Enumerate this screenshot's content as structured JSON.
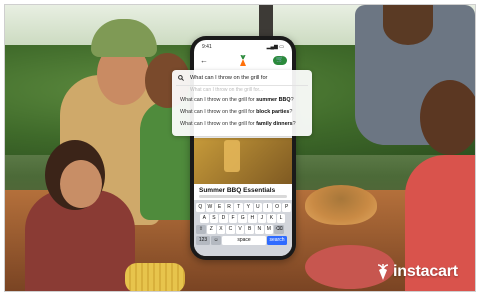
{
  "search": {
    "query": "What can I throw on the grill for",
    "ghost": "What can I throw on the grill for..."
  },
  "suggestions": [
    {
      "prefix": "What can I throw on the grill for ",
      "bold": "summer BBQ",
      "suffix": "?"
    },
    {
      "prefix": "What can I throw on the grill for ",
      "bold": "block parties",
      "suffix": "?"
    },
    {
      "prefix": "What can I throw on the grill for ",
      "bold": "family dinners",
      "suffix": "?"
    }
  ],
  "phone": {
    "time": "9:41",
    "card_title": "Summer BBQ Essentials",
    "keyboard": {
      "row1": [
        "Q",
        "W",
        "E",
        "R",
        "T",
        "Y",
        "U",
        "I",
        "O",
        "P"
      ],
      "row2": [
        "A",
        "S",
        "D",
        "F",
        "G",
        "H",
        "J",
        "K",
        "L"
      ],
      "row3": [
        "Z",
        "X",
        "C",
        "V",
        "B",
        "N",
        "M"
      ],
      "numbers_key": "123",
      "space_key": "space",
      "search_key": "search"
    }
  },
  "brand": {
    "logo_text": "instacart",
    "accent": "#2a8a3b",
    "logo_carrot": "#ff7009"
  }
}
